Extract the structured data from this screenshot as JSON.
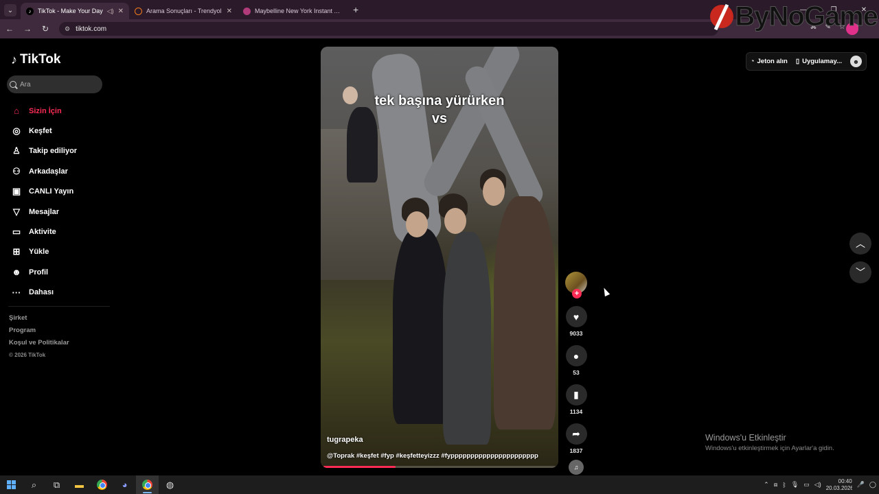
{
  "browser": {
    "tabs": [
      {
        "title": "TikTok - Make Your Day",
        "active": true
      },
      {
        "title": "Arama Sonuçları - Trendyol",
        "active": false
      },
      {
        "title": "Maybelline New York Instant Age",
        "active": false
      }
    ],
    "url": "tiktok.com",
    "new_tab_label": "+"
  },
  "watermark": {
    "text": "ByNoGame"
  },
  "sidebar": {
    "logo_text": "TikTok",
    "search_placeholder": "Ara",
    "items": [
      {
        "label": "Sizin İçin",
        "icon": "home-icon",
        "active": true
      },
      {
        "label": "Keşfet",
        "icon": "compass-icon"
      },
      {
        "label": "Takip ediliyor",
        "icon": "following-icon"
      },
      {
        "label": "Arkadaşlar",
        "icon": "friends-icon"
      },
      {
        "label": "CANLI Yayın",
        "icon": "live-icon"
      },
      {
        "label": "Mesajlar",
        "icon": "messages-icon"
      },
      {
        "label": "Aktivite",
        "icon": "activity-icon"
      },
      {
        "label": "Yükle",
        "icon": "upload-icon"
      },
      {
        "label": "Profil",
        "icon": "profile-icon"
      },
      {
        "label": "Dahası",
        "icon": "more-icon"
      }
    ],
    "footer": {
      "company": "Şirket",
      "program": "Program",
      "terms": "Koşul ve Politikalar",
      "copyright": "© 2026 TikTok"
    }
  },
  "topbar": {
    "coins_label": "Jeton alın",
    "app_label": "Uygulamay..."
  },
  "video": {
    "overlay_line1": "tek başına yürürken",
    "overlay_line2": "vs",
    "author": "tugrapeka",
    "description": "@Toprak #keşfet #fyp #keşfetteyizzz #fypppppppppppppppppppppp",
    "progress": 0.31
  },
  "actions": {
    "likes": "9033",
    "comments": "53",
    "saves": "1134",
    "shares": "1837"
  },
  "windows_activation": {
    "title": "Windows'u Etkinleştir",
    "subtitle": "Windows'u etkinleştirmek için Ayarlar'a gidin."
  },
  "taskbar": {
    "time": "00:40",
    "date": "20.03.2026"
  }
}
